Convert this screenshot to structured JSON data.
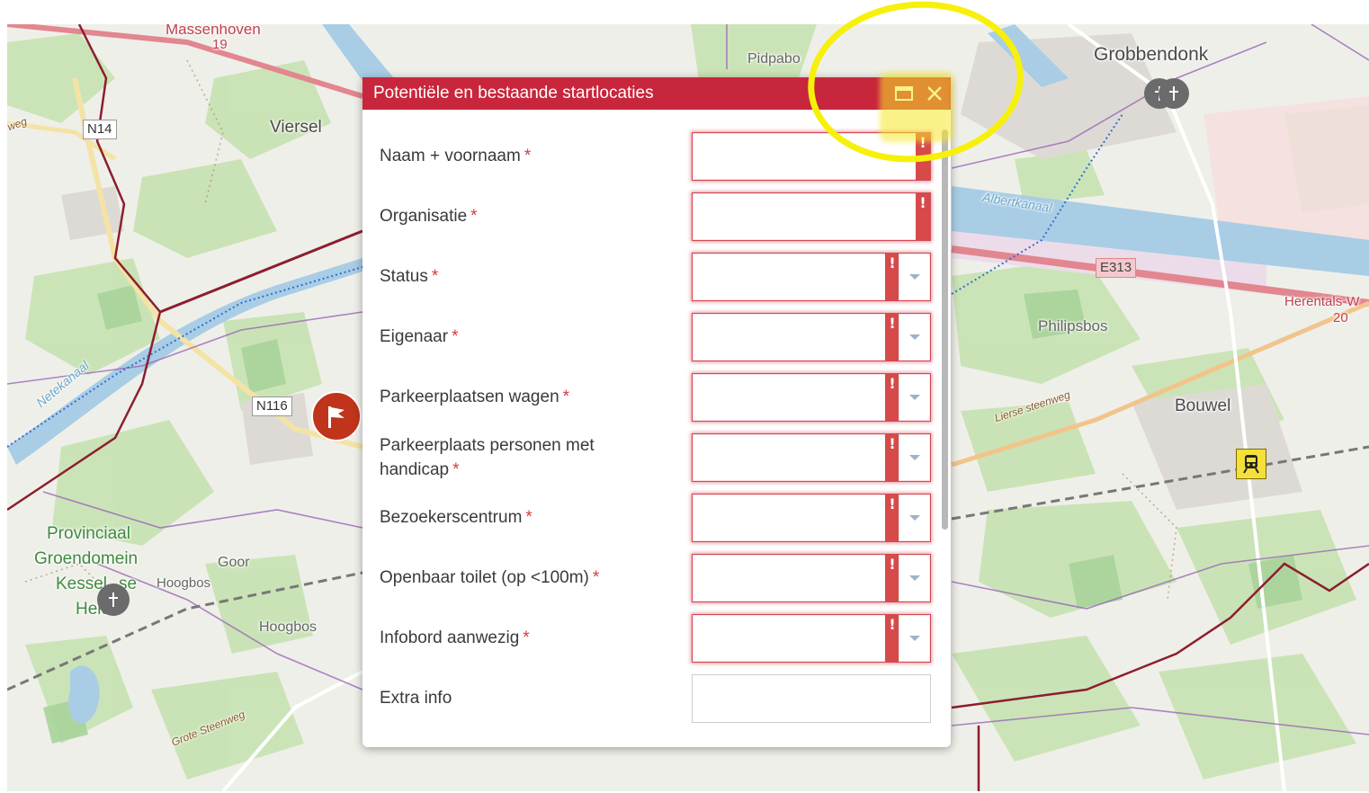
{
  "map": {
    "places": {
      "massenhoven": "Massenhoven",
      "massenhoven_number": "19",
      "viersel": "Viersel",
      "pidpa": "Pidpabo",
      "grobbendonk": "Grobbendonk",
      "philipsbos": "Philipsbos",
      "bouwel": "Bouwel",
      "herentals": "Herentals-W",
      "herentals_number": "20",
      "provinciaal": "Provinciaal",
      "groendomein": "Groendomein",
      "kessel": "Kessel",
      "kessel_se": "se",
      "heide": "Heide",
      "goor": "Goor",
      "hoogbos_small": "Hoogbos",
      "hoogbos": "Hoogbos"
    },
    "roads": {
      "n14": "N14",
      "n116": "N116",
      "e313": "E313",
      "lierse_steenweg": "Lierse steenweg",
      "grote_steenweg": "Grote Steenweg",
      "weg": "weg"
    },
    "water": {
      "albertkanaal": "Albertkanaal",
      "netekanaal": "Netekanaal"
    },
    "icons": {
      "poi": "church-icon",
      "flag": "flag-marker-icon",
      "train": "train-station-icon"
    }
  },
  "dialog": {
    "title": "Potentiële en bestaande startlocaties",
    "header_color": "#c8263c",
    "icons": {
      "maximize": "maximize-icon",
      "close": "close-icon"
    },
    "fields": [
      {
        "label": "Naam + voornaam",
        "required": "*",
        "type": "text",
        "value": "",
        "error": "!"
      },
      {
        "label": "Organisatie",
        "required": "*",
        "type": "text",
        "value": "",
        "error": "!"
      },
      {
        "label": "Status",
        "required": "*",
        "type": "select",
        "value": "",
        "error": "!"
      },
      {
        "label": "Eigenaar",
        "required": "*",
        "type": "select",
        "value": "",
        "error": "!"
      },
      {
        "label": "Parkeerplaatsen wagen",
        "required": "*",
        "type": "select",
        "value": "",
        "error": "!"
      },
      {
        "label": "Parkeerplaats personen met handicap",
        "required": "*",
        "type": "select",
        "value": "",
        "error": "!"
      },
      {
        "label": "Bezoekerscentrum",
        "required": "*",
        "type": "select",
        "value": "",
        "error": "!"
      },
      {
        "label": "Openbaar toilet (op <100m)",
        "required": "*",
        "type": "select",
        "value": "",
        "error": "!"
      },
      {
        "label": "Infobord aanwezig",
        "required": "*",
        "type": "select",
        "value": "",
        "error": "!"
      },
      {
        "label": "Extra info",
        "required": "",
        "type": "text",
        "value": "",
        "error": ""
      }
    ]
  },
  "annotation": {
    "color": "#f7f00a"
  }
}
